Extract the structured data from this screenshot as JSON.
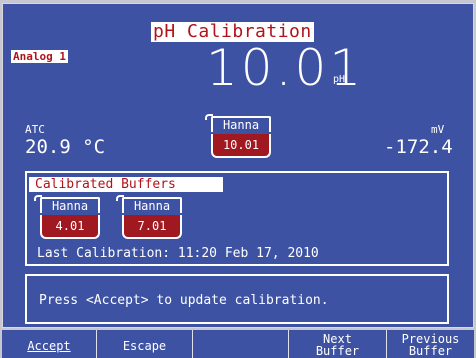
{
  "screen": {
    "title": "pH Calibration",
    "channel": "Analog 1",
    "reading": "10.01",
    "reading_unit": "pH",
    "atc": {
      "label": "ATC",
      "value": "20.9 °C"
    },
    "mv": {
      "label": "mV",
      "value": "-172.4"
    },
    "current_buffer": {
      "name": "Hanna",
      "value": "10.01"
    }
  },
  "calibrated_buffers": {
    "header": "Calibrated Buffers",
    "buffers": [
      {
        "name": "Hanna",
        "value": "4.01"
      },
      {
        "name": "Hanna",
        "value": "7.01"
      }
    ],
    "last_calibration": "Last Calibration: 11:20 Feb 17, 2010"
  },
  "message": "Press <Accept> to update calibration.",
  "softkeys": {
    "accept": "Accept",
    "escape": "Escape",
    "blank": "",
    "next_line1": "Next",
    "next_line2": "Buffer",
    "prev_line1": "Previous",
    "prev_line2": "Buffer"
  },
  "colors": {
    "background": "#3d52a3",
    "accent_red": "#b0131b",
    "buffer_fill": "#a01820",
    "text": "#ffffff"
  }
}
